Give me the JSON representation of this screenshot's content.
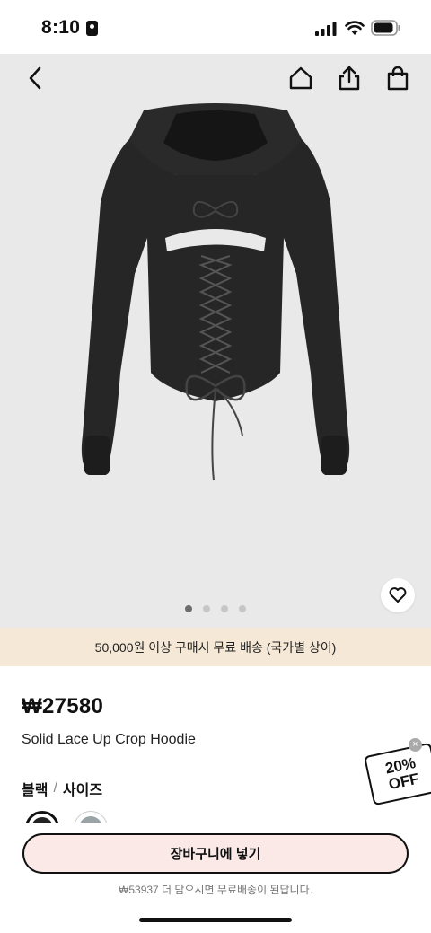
{
  "status_bar": {
    "time": "8:10"
  },
  "product": {
    "price": "₩27580",
    "name": "Solid Lace Up Crop Hoodie",
    "image_count": 4,
    "active_image_index": 0
  },
  "banner": {
    "text": "50,000원 이상 구매시 무료 배송 (국가별 상이)"
  },
  "variant": {
    "color": "블랙",
    "separator": "/",
    "size_label": "사이즈"
  },
  "cta": {
    "add_to_cart": "장바구니에 넣기",
    "free_shipping_note": "₩53937 더 담으시면 무료배송이 된답니다."
  },
  "coupon": {
    "percent": "20%",
    "off": "OFF"
  },
  "colors": {
    "banner_bg": "#f5e8d6",
    "cta_bg": "#fae9e6",
    "image_bg": "#e9e9e9"
  }
}
